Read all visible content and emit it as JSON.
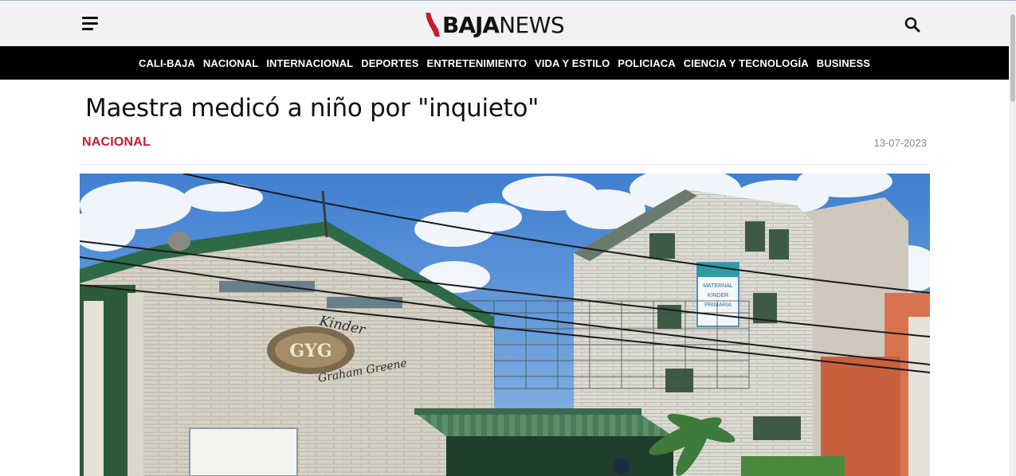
{
  "header": {
    "logo_bold": "BAJA",
    "logo_light": "NEWS",
    "menu_icon": "hamburger-menu-icon",
    "search_icon": "search-icon",
    "brand_color": "#c41e2a"
  },
  "nav": {
    "items": [
      {
        "label": "CALI-BAJA"
      },
      {
        "label": "NACIONAL"
      },
      {
        "label": "INTERNACIONAL"
      },
      {
        "label": "DEPORTES"
      },
      {
        "label": "ENTRETENIMIENTO"
      },
      {
        "label": "VIDA Y ESTILO"
      },
      {
        "label": "POLICIACA"
      },
      {
        "label": "CIENCIA Y TECNOLOGÍA"
      },
      {
        "label": "BUSINESS"
      }
    ]
  },
  "article": {
    "title": "Maestra medicó a niño por \"inquieto\"",
    "category": "NACIONAL",
    "date": "13-07-2023",
    "image": {
      "sign_line1": "Kinder",
      "sign_line2": "Graham Greene",
      "emblem": "GYG",
      "side_sign": [
        "MATERNAL",
        "KINDER",
        "PRIMARIA"
      ]
    }
  }
}
